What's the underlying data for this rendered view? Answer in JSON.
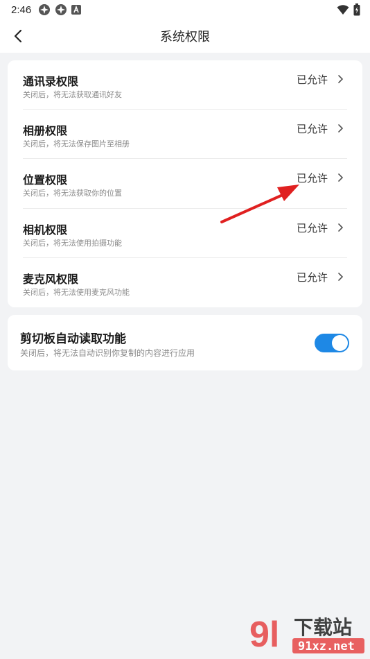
{
  "status_bar": {
    "time": "2:46",
    "icons_left": [
      "app-notification-icon",
      "app-notification-icon",
      "a-letter-notification-icon"
    ],
    "icons_right": [
      "wifi-icon",
      "battery-charging-icon"
    ]
  },
  "nav": {
    "title": "系统权限",
    "back_icon": "chevron-left-icon"
  },
  "permissions": [
    {
      "title": "通讯录权限",
      "desc": "关闭后，将无法获取通讯好友",
      "status": "已允许"
    },
    {
      "title": "相册权限",
      "desc": "关闭后，将无法保存图片至相册",
      "status": "已允许"
    },
    {
      "title": "位置权限",
      "desc": "关闭后，将无法获取你的位置",
      "status": "已允许"
    },
    {
      "title": "相机权限",
      "desc": "关闭后，将无法使用拍摄功能",
      "status": "已允许"
    },
    {
      "title": "麦克风权限",
      "desc": "关闭后，将无法使用麦克风功能",
      "status": "已允许"
    }
  ],
  "clipboard": {
    "title": "剪切板自动读取功能",
    "desc": "关闭后，将无法自动识别你复制的内容进行应用",
    "enabled": true
  },
  "colors": {
    "accent": "#1e88e5",
    "annotation_arrow": "#e02020",
    "background": "#f2f3f5"
  },
  "watermark": {
    "logo_text": "9l",
    "brand_text": "下载站",
    "site_text": "91xz.net"
  }
}
